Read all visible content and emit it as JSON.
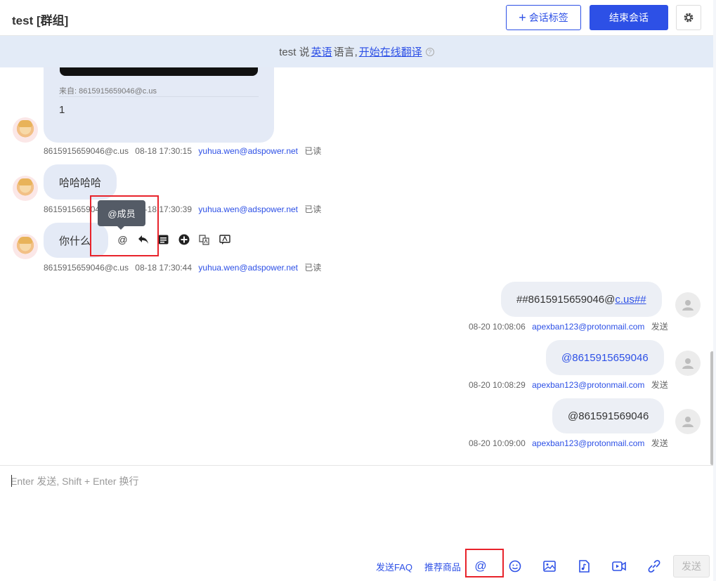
{
  "header": {
    "title": "test [群组]",
    "tag_button": "会话标签",
    "end_button": "结束会话",
    "colors": {
      "accent": "#2d50e6"
    }
  },
  "banner": {
    "prefix": "test 说",
    "language": "英语",
    "middle": "语言,",
    "translate_link": "开始在线翻译"
  },
  "messages_in": [
    {
      "from_label": "来自: 8615915659046@c.us",
      "text": "1",
      "sender": "8615915659046@c.us",
      "time": "08-18 17:30:15",
      "account": "yuhua.wen@adspower.net",
      "status": "已读"
    },
    {
      "text": "哈哈哈哈",
      "sender": "8615915659046@c.us",
      "time": "08-18 17:30:39",
      "account": "yuhua.wen@adspower.net",
      "status": "已读"
    },
    {
      "text": "你什么",
      "sender": "8615915659046@c.us",
      "time": "08-18 17:30:44",
      "account": "yuhua.wen@adspower.net",
      "status": "已读"
    }
  ],
  "messages_out": [
    {
      "text_prefix": "##8615915659046@",
      "text_link": "c.us##",
      "time": "08-20 10:08:06",
      "account": "apexban123@protonmail.com",
      "status": "发送"
    },
    {
      "text": "@8615915659046",
      "time": "08-20 10:08:29",
      "account": "apexban123@protonmail.com",
      "status": "发送"
    },
    {
      "text": "@861591569046",
      "time": "08-20 10:09:00",
      "account": "apexban123@protonmail.com",
      "status": "发送"
    }
  ],
  "tooltip": "@成员",
  "toolbar": {
    "at": "@"
  },
  "composer": {
    "placeholder": "Enter 发送, Shift + Enter 换行",
    "faq": "发送FAQ",
    "goods": "推荐商品",
    "at": "@",
    "send": "发送"
  }
}
